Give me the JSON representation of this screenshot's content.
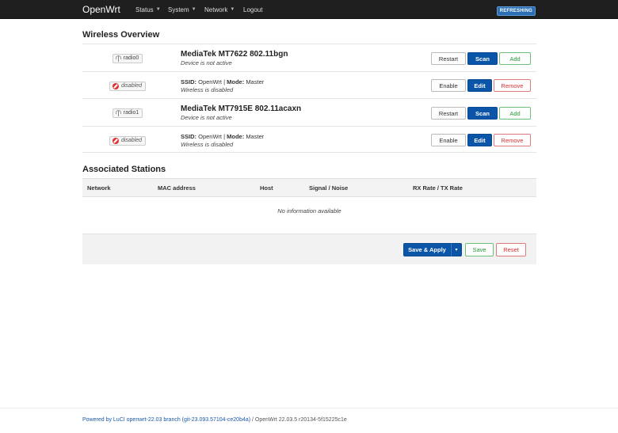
{
  "header": {
    "brand": "OpenWrt",
    "menu": [
      {
        "label": "Status",
        "has_caret": true
      },
      {
        "label": "System",
        "has_caret": true
      },
      {
        "label": "Network",
        "has_caret": true
      },
      {
        "label": "Logout",
        "has_caret": false
      }
    ],
    "badge": "REFRESHING"
  },
  "wireless": {
    "title": "Wireless Overview",
    "rows": [
      {
        "badge": "radio0",
        "title": "MediaTek MT7622 802.11bgn",
        "status": "Device is not active",
        "buttons": [
          "Restart",
          "Scan",
          "Add"
        ]
      },
      {
        "badge": "disabled",
        "ssid_label": "SSID:",
        "ssid": "OpenWrt",
        "sep": "|",
        "mode_label": "Mode:",
        "mode": "Master",
        "status": "Wireless is disabled",
        "buttons": [
          "Enable",
          "Edit",
          "Remove"
        ]
      },
      {
        "badge": "radio1",
        "title": "MediaTek MT7915E 802.11acaxn",
        "status": "Device is not active",
        "buttons": [
          "Restart",
          "Scan",
          "Add"
        ]
      },
      {
        "badge": "disabled",
        "ssid_label": "SSID:",
        "ssid": "OpenWrt",
        "sep": "|",
        "mode_label": "Mode:",
        "mode": "Master",
        "status": "Wireless is disabled",
        "buttons": [
          "Enable",
          "Edit",
          "Remove"
        ]
      }
    ]
  },
  "stations": {
    "title": "Associated Stations",
    "columns": [
      "Network",
      "MAC address",
      "Host",
      "Signal / Noise",
      "RX Rate / TX Rate"
    ],
    "empty": "No information available"
  },
  "actions": {
    "save_apply": "Save & Apply",
    "dropdown": "▾",
    "save": "Save",
    "reset": "Reset"
  },
  "footer": {
    "powered": "Powered by LuCI openwrt-22.03 branch (git-23.093.57104-ce20b4a)",
    "version": " / OpenWrt 22.03.5 r20134-5f15225c1e"
  },
  "colors": {
    "header_bg": "#1f1f1f",
    "primary": "#0b55a8",
    "positive": "#2b9a3c",
    "negative": "#dd3333",
    "badge_bg": "#2a6fb3"
  }
}
